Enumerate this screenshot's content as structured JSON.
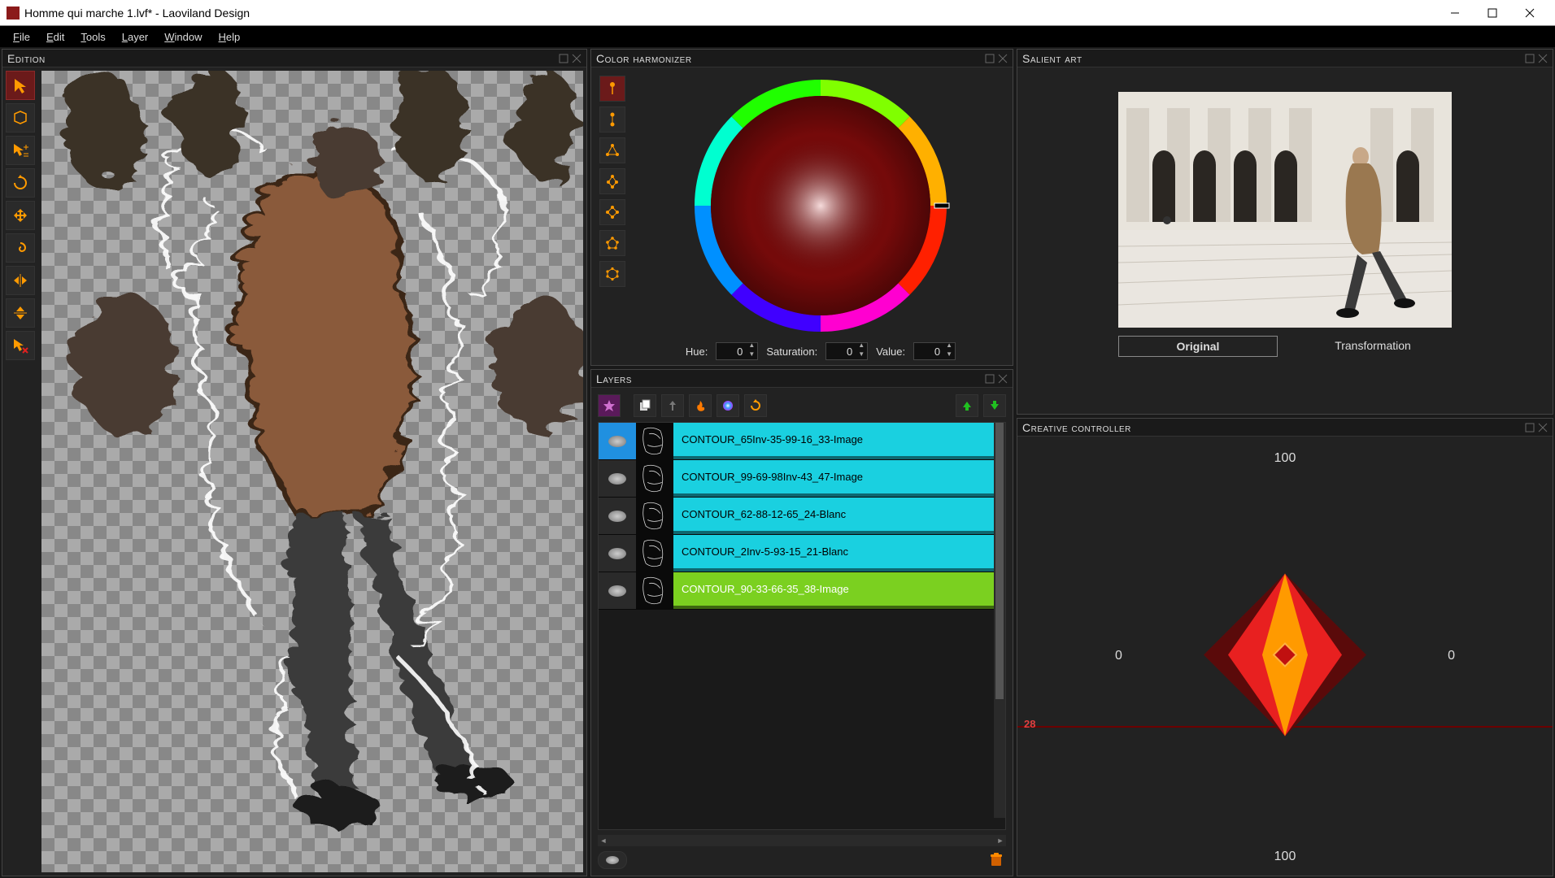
{
  "window": {
    "title": "Homme qui marche 1.lvf* - Laoviland Design"
  },
  "menu": {
    "items": [
      "File",
      "Edit",
      "Tools",
      "Layer",
      "Window",
      "Help"
    ]
  },
  "panels": {
    "edition": {
      "title": "Edition"
    },
    "color_harmonizer": {
      "title": "Color harmonizer",
      "hue_label": "Hue:",
      "hue_value": "0",
      "sat_label": "Saturation:",
      "sat_value": "0",
      "val_label": "Value:",
      "val_value": "0"
    },
    "layers": {
      "title": "Layers",
      "items": [
        {
          "name": "CONTOUR_65Inv-35-99-16_33-Image",
          "style": "blue"
        },
        {
          "name": "CONTOUR_99-69-98Inv-43_47-Image",
          "style": "cyan"
        },
        {
          "name": "CONTOUR_62-88-12-65_24-Blanc",
          "style": "cyan"
        },
        {
          "name": "CONTOUR_2Inv-5-93-15_21-Blanc",
          "style": "cyan"
        },
        {
          "name": "CONTOUR_90-33-66-35_38-Image",
          "style": "green"
        }
      ]
    },
    "salient": {
      "title": "Salient art",
      "tab_original": "Original",
      "tab_transformation": "Transformation"
    },
    "creative": {
      "title": "Creative controller",
      "top": "100",
      "bottom": "100",
      "left": "0",
      "right": "0",
      "slider_value": "28"
    }
  }
}
